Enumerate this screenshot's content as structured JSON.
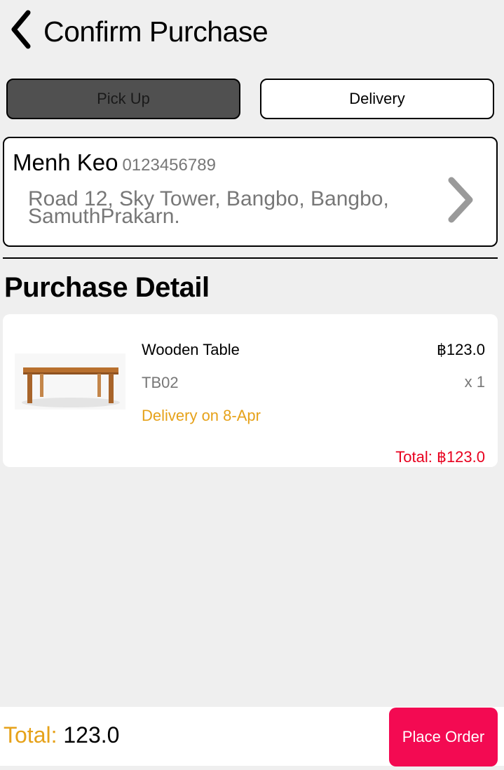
{
  "header": {
    "title": "Confirm Purchase",
    "back_icon": "chevron-left-icon"
  },
  "toggle": {
    "pickup_label": "Pick Up",
    "delivery_label": "Delivery",
    "selected": "Pick Up"
  },
  "address": {
    "name": "Menh Keo",
    "phone": "0123456789",
    "line": "Road 12, Sky Tower, Bangbo, Bangbo, SamuthPrakarn.",
    "chevron_icon": "chevron-right-icon"
  },
  "section": {
    "title": "Purchase Detail"
  },
  "item": {
    "name": "Wooden Table",
    "sku": "TB02",
    "delivery": "Delivery on 8-Apr",
    "price": "฿123.0",
    "qty": "x 1",
    "total": "Total: ฿123.0",
    "image_icon": "wooden-table-image"
  },
  "footer": {
    "total_label": "Total:",
    "total_value": "123.0",
    "place_order_label": "Place Order"
  },
  "colors": {
    "accent_orange": "#e6a21a",
    "price_red": "#e8001e",
    "button_pink": "#f30a52",
    "selected_toggle": "#505050"
  }
}
